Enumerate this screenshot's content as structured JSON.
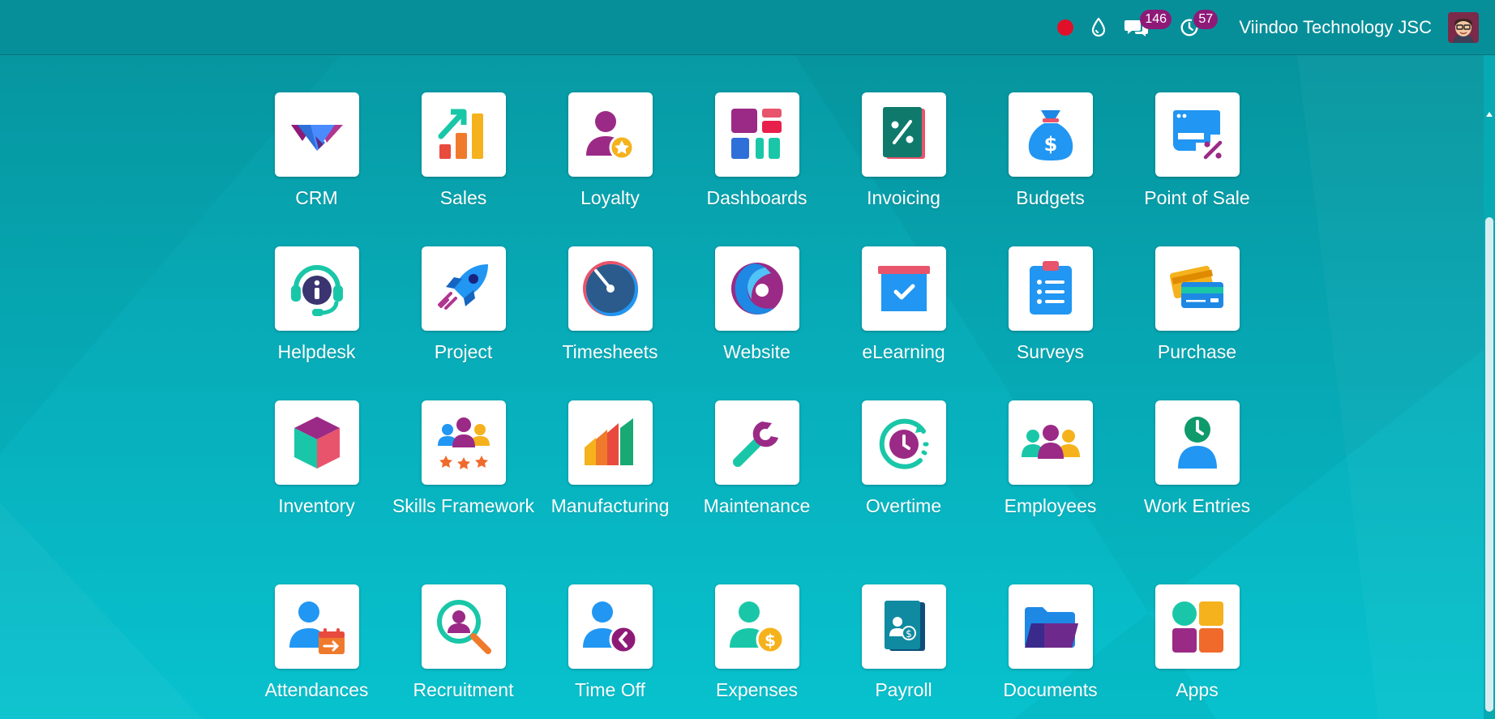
{
  "navbar": {
    "company": "Viindoo Technology JSC",
    "recording_color": "#e0102b",
    "icons": [
      "record-dot",
      "droplet-icon",
      "chat-icon",
      "activity-clock-icon"
    ],
    "messages_count": "146",
    "activities_count": "57",
    "badge_color": "#8e1a78"
  },
  "apps": [
    {
      "label": "CRM",
      "icon": "handshake-icon"
    },
    {
      "label": "Sales",
      "icon": "bar-chart-arrow-icon"
    },
    {
      "label": "Loyalty",
      "icon": "user-star-icon"
    },
    {
      "label": "Dashboards",
      "icon": "dashboard-tiles-icon"
    },
    {
      "label": "Invoicing",
      "icon": "percent-document-icon"
    },
    {
      "label": "Budgets",
      "icon": "money-bag-icon"
    },
    {
      "label": "Point of Sale",
      "icon": "shop-percent-icon"
    },
    {
      "label": "Helpdesk",
      "icon": "headset-info-icon"
    },
    {
      "label": "Project",
      "icon": "rocket-icon"
    },
    {
      "label": "Timesheets",
      "icon": "gauge-icon"
    },
    {
      "label": "Website",
      "icon": "swirl-globe-icon"
    },
    {
      "label": "eLearning",
      "icon": "checkbox-box-icon"
    },
    {
      "label": "Surveys",
      "icon": "clipboard-list-icon"
    },
    {
      "label": "Purchase",
      "icon": "credit-cards-icon"
    },
    {
      "label": "Inventory",
      "icon": "cube-icon"
    },
    {
      "label": "Skills Framework",
      "icon": "team-stars-icon"
    },
    {
      "label": "Manufacturing",
      "icon": "factory-bars-icon"
    },
    {
      "label": "Maintenance",
      "icon": "wrench-icon"
    },
    {
      "label": "Overtime",
      "icon": "clock-cycle-icon"
    },
    {
      "label": "Employees",
      "icon": "group-icon"
    },
    {
      "label": "Work Entries",
      "icon": "user-clock-icon"
    },
    {
      "label": "Attendances",
      "icon": "user-calendar-icon"
    },
    {
      "label": "Recruitment",
      "icon": "magnifier-user-icon"
    },
    {
      "label": "Time Off",
      "icon": "user-back-icon"
    },
    {
      "label": "Expenses",
      "icon": "user-coin-icon"
    },
    {
      "label": "Payroll",
      "icon": "payslip-icon"
    },
    {
      "label": "Documents",
      "icon": "folder-icon"
    },
    {
      "label": "Apps",
      "icon": "app-blocks-icon"
    }
  ]
}
